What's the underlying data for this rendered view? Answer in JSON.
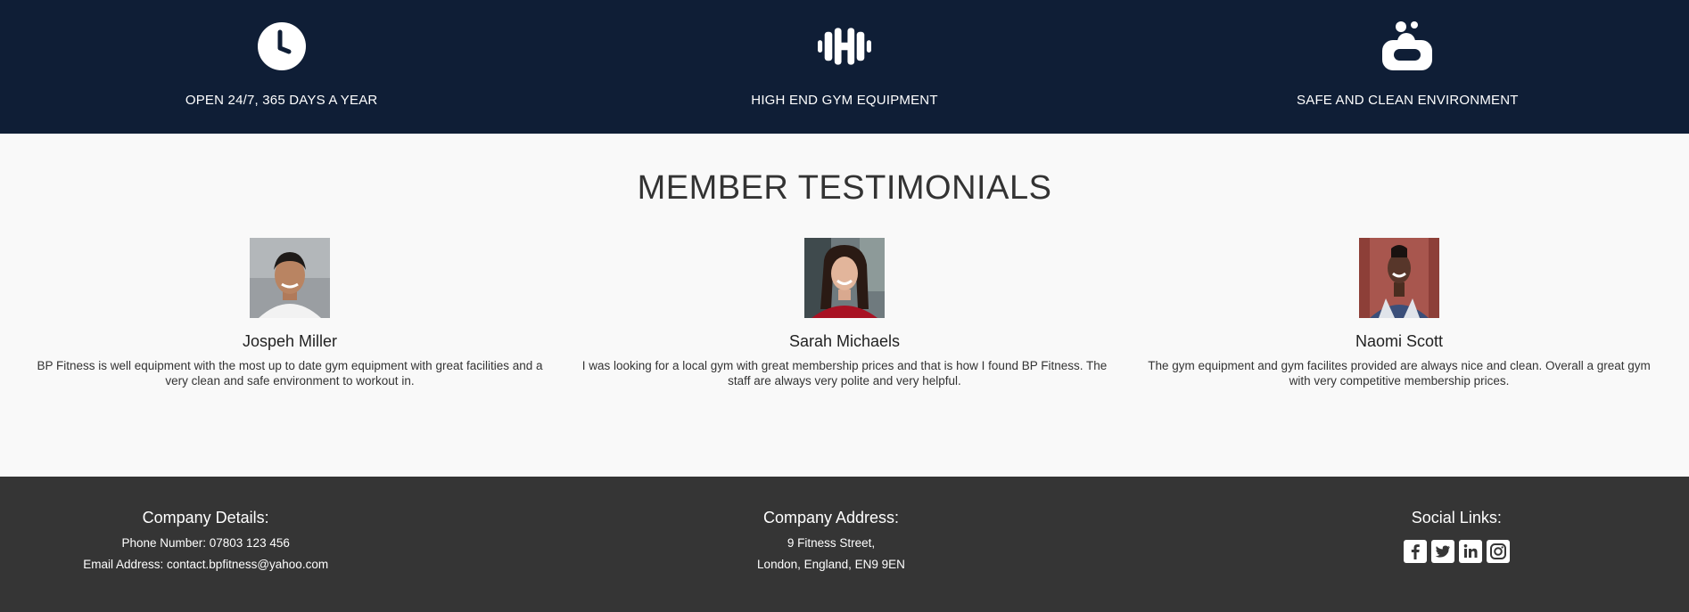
{
  "features": [
    {
      "icon": "clock-icon",
      "label": "OPEN 24/7, 365 DAYS A YEAR"
    },
    {
      "icon": "dumbbell-icon",
      "label": "HIGH END GYM EQUIPMENT"
    },
    {
      "icon": "soap-icon",
      "label": "SAFE AND CLEAN ENVIRONMENT"
    }
  ],
  "testimonials": {
    "title": "MEMBER TESTIMONIALS",
    "members": [
      {
        "name": "Jospeh Miller",
        "quote": "BP Fitness is well equipment with the most up to date gym equipment with great facilities and a very clean and safe environment to workout in."
      },
      {
        "name": "Sarah Michaels",
        "quote": "I was looking for a local gym with great membership prices and that is how I found BP Fitness. The staff are always very polite and very helpful."
      },
      {
        "name": "Naomi Scott",
        "quote": "The gym equipment and gym facilites provided are always nice and clean. Overall a great gym with very competitive membership prices."
      }
    ]
  },
  "footer": {
    "company": {
      "heading": "Company Details:",
      "phone": "Phone Number: 07803 123 456",
      "email": "Email Address: contact.bpfitness@yahoo.com"
    },
    "address": {
      "heading": "Company Address:",
      "line1": "9 Fitness Street,",
      "line2": "London, England, EN9 9EN"
    },
    "social": {
      "heading": "Social Links:",
      "links": [
        "facebook-icon",
        "twitter-icon",
        "linkedin-icon",
        "instagram-icon"
      ]
    }
  },
  "colors": {
    "navy": "#0f1e36",
    "footer": "#353535",
    "background": "#f9f9f9"
  }
}
